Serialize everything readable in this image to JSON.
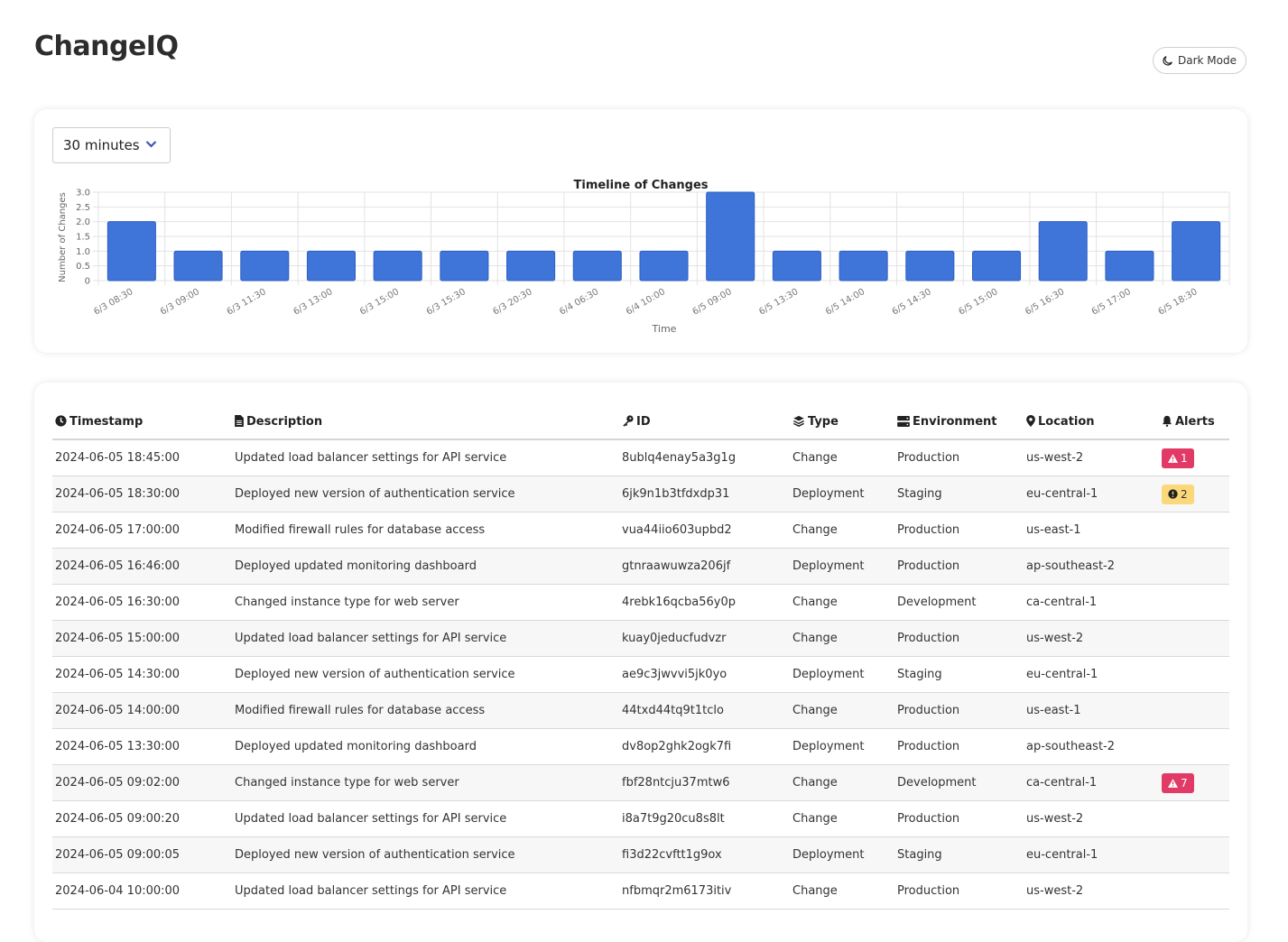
{
  "app": {
    "title": "ChangeIQ"
  },
  "theme_toggle": {
    "label": "Dark Mode",
    "icon": "moon-icon"
  },
  "interval_select": {
    "selected": "30 minutes"
  },
  "colors": {
    "bar": "#3f74d8",
    "bar_stroke": "#2e5fc4",
    "danger": "#e23a67",
    "warning": "#fbd97a"
  },
  "chart_data": {
    "type": "bar",
    "title": "Timeline of Changes",
    "xlabel": "Time",
    "ylabel": "Number of Changes",
    "ylim": [
      0,
      3
    ],
    "yticks": [
      "0",
      "0.5",
      "1.0",
      "1.5",
      "2.0",
      "2.5",
      "3.0"
    ],
    "grid": true,
    "categories": [
      "6/3 08:30",
      "6/3 09:00",
      "6/3 11:30",
      "6/3 13:00",
      "6/3 15:00",
      "6/3 15:30",
      "6/3 20:30",
      "6/4 06:30",
      "6/4 10:00",
      "6/5 09:00",
      "6/5 13:30",
      "6/5 14:00",
      "6/5 14:30",
      "6/5 15:00",
      "6/5 16:30",
      "6/5 17:00",
      "6/5 18:30"
    ],
    "values": [
      2,
      1,
      1,
      1,
      1,
      1,
      1,
      1,
      1,
      3,
      1,
      1,
      1,
      1,
      2,
      1,
      2
    ]
  },
  "table": {
    "headers": [
      {
        "label": "Timestamp",
        "icon": "clock-icon"
      },
      {
        "label": "Description",
        "icon": "file-icon"
      },
      {
        "label": "ID",
        "icon": "key-icon"
      },
      {
        "label": "Type",
        "icon": "layers-icon"
      },
      {
        "label": "Environment",
        "icon": "server-icon"
      },
      {
        "label": "Location",
        "icon": "map-pin-icon"
      },
      {
        "label": "Alerts",
        "icon": "bell-icon"
      }
    ],
    "rows": [
      {
        "timestamp": "2024-06-05 18:45:00",
        "description": "Updated load balancer settings for API service",
        "id": "8ublq4enay5a3g1g",
        "type": "Change",
        "environment": "Production",
        "location": "us-west-2",
        "alert": {
          "count": "1",
          "level": "danger",
          "icon": "warning-triangle-icon"
        }
      },
      {
        "timestamp": "2024-06-05 18:30:00",
        "description": "Deployed new version of authentication service",
        "id": "6jk9n1b3tfdxdp31",
        "type": "Deployment",
        "environment": "Staging",
        "location": "eu-central-1",
        "alert": {
          "count": "2",
          "level": "warning",
          "icon": "exclamation-circle-icon"
        }
      },
      {
        "timestamp": "2024-06-05 17:00:00",
        "description": "Modified firewall rules for database access",
        "id": "vua44iio603upbd2",
        "type": "Change",
        "environment": "Production",
        "location": "us-east-1",
        "alert": null
      },
      {
        "timestamp": "2024-06-05 16:46:00",
        "description": "Deployed updated monitoring dashboard",
        "id": "gtnraawuwza206jf",
        "type": "Deployment",
        "environment": "Production",
        "location": "ap-southeast-2",
        "alert": null
      },
      {
        "timestamp": "2024-06-05 16:30:00",
        "description": "Changed instance type for web server",
        "id": "4rebk16qcba56y0p",
        "type": "Change",
        "environment": "Development",
        "location": "ca-central-1",
        "alert": null
      },
      {
        "timestamp": "2024-06-05 15:00:00",
        "description": "Updated load balancer settings for API service",
        "id": "kuay0jeducfudvzr",
        "type": "Change",
        "environment": "Production",
        "location": "us-west-2",
        "alert": null
      },
      {
        "timestamp": "2024-06-05 14:30:00",
        "description": "Deployed new version of authentication service",
        "id": "ae9c3jwvvi5jk0yo",
        "type": "Deployment",
        "environment": "Staging",
        "location": "eu-central-1",
        "alert": null
      },
      {
        "timestamp": "2024-06-05 14:00:00",
        "description": "Modified firewall rules for database access",
        "id": "44txd44tq9t1tclo",
        "type": "Change",
        "environment": "Production",
        "location": "us-east-1",
        "alert": null
      },
      {
        "timestamp": "2024-06-05 13:30:00",
        "description": "Deployed updated monitoring dashboard",
        "id": "dv8op2ghk2ogk7fi",
        "type": "Deployment",
        "environment": "Production",
        "location": "ap-southeast-2",
        "alert": null
      },
      {
        "timestamp": "2024-06-05 09:02:00",
        "description": "Changed instance type for web server",
        "id": "fbf28ntcju37mtw6",
        "type": "Change",
        "environment": "Development",
        "location": "ca-central-1",
        "alert": {
          "count": "7",
          "level": "danger",
          "icon": "warning-triangle-icon"
        }
      },
      {
        "timestamp": "2024-06-05 09:00:20",
        "description": "Updated load balancer settings for API service",
        "id": "i8a7t9g20cu8s8lt",
        "type": "Change",
        "environment": "Production",
        "location": "us-west-2",
        "alert": null
      },
      {
        "timestamp": "2024-06-05 09:00:05",
        "description": "Deployed new version of authentication service",
        "id": "fi3d22cvftt1g9ox",
        "type": "Deployment",
        "environment": "Staging",
        "location": "eu-central-1",
        "alert": null
      },
      {
        "timestamp": "2024-06-04 10:00:00",
        "description": "Updated load balancer settings for API service",
        "id": "nfbmqr2m6173itiv",
        "type": "Change",
        "environment": "Production",
        "location": "us-west-2",
        "alert": null
      }
    ]
  }
}
